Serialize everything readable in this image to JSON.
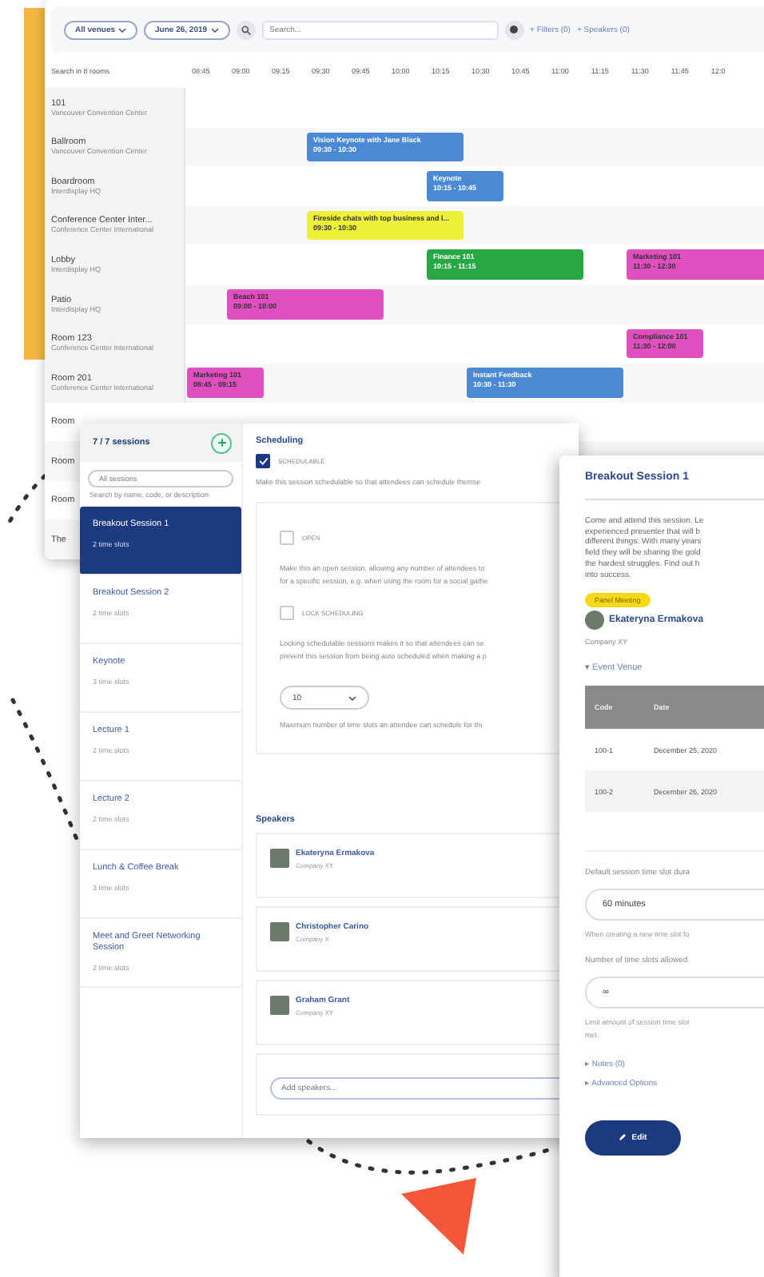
{
  "timeline": {
    "filters": [
      {
        "label": "All venues"
      },
      {
        "label": "June 26, 2019"
      }
    ],
    "search": {
      "placeholder": "Search..."
    },
    "links": [
      "+ Filters (0)",
      "+ Speakers (0)"
    ],
    "rooms_header": "Search in 8 rooms",
    "times": [
      "08:45",
      "09:00",
      "09:15",
      "09:30",
      "09:45",
      "10:00",
      "10:15",
      "10:30",
      "10:45",
      "11:00",
      "11:15",
      "11:30",
      "11:45",
      "12:0"
    ],
    "rooms": [
      {
        "name": "101",
        "venue": "Vancouver Convention Center"
      },
      {
        "name": "Ballroom",
        "venue": "Vancouver Convention Center",
        "events": [
          {
            "title": "Vision Keynote with Jane Black",
            "time": "09:30 - 10:30",
            "color": "#4a8ad4"
          }
        ]
      },
      {
        "name": "Boardroom",
        "venue": "Interdisplay HQ",
        "events": [
          {
            "title": "Keynote",
            "time": "10:15 - 10:45",
            "color": "#4a8ad4"
          }
        ]
      },
      {
        "name": "Conference Center Inter...",
        "venue": "Conference Center International",
        "events": [
          {
            "title": "Fireside chats with top business and l...",
            "time": "09:30 - 10:30",
            "color": "#eef03a"
          }
        ]
      },
      {
        "name": "Lobby",
        "venue": "Interdisplay HQ",
        "events": [
          {
            "title": "Finance 101",
            "time": "10:15 - 11:15",
            "color": "#28a745"
          },
          {
            "title": "Marketing 101",
            "time": "11:30 - 12:30",
            "color": "#e04fc0"
          }
        ]
      },
      {
        "name": "Patio",
        "venue": "Interdisplay HQ",
        "events": [
          {
            "title": "Beach 101",
            "time": "09:00 - 10:00",
            "color": "#e04fc0"
          }
        ]
      },
      {
        "name": "Room 123",
        "venue": "Conference Center International",
        "events": [
          {
            "title": "Compliance 101",
            "time": "11:30 - 12:00",
            "color": "#e04fc0"
          }
        ]
      },
      {
        "name": "Room 201",
        "venue": "Conference Center International",
        "events": [
          {
            "title": "Marketing 101",
            "time": "08:45 - 09:15",
            "color": "#e04fc0"
          },
          {
            "title": "Instant Feedback",
            "time": "10:30 - 11:30",
            "color": "#4a8ad4"
          }
        ]
      },
      {
        "name": "Room"
      },
      {
        "name": "Room"
      },
      {
        "name": "Room"
      },
      {
        "name": "The"
      }
    ]
  },
  "sessions_window": {
    "sidebar": {
      "count": "7 / 7 sessions",
      "search": {
        "placeholder": "All sessions"
      },
      "hint": "Search by name, code, or description",
      "sessions": [
        {
          "name": "Breakout Session 1",
          "slots": "2 time slots",
          "selected": true
        },
        {
          "name": "Breakout Session 2",
          "slots": "2 time slots",
          "selected": false
        },
        {
          "name": "Keynote",
          "slots": "3 time slots",
          "selected": false
        },
        {
          "name": "Lecture 1",
          "slots": "2 time slots",
          "selected": false
        },
        {
          "name": "Lecture 2",
          "slots": "2 time slots",
          "selected": false
        },
        {
          "name": "Lunch & Coffee Break",
          "slots": "3 time slots",
          "selected": false
        },
        {
          "name": "Meet and Greet Networking Session",
          "slots": "2 time slots",
          "selected": false
        }
      ]
    },
    "scheduling": {
      "title": "Scheduling",
      "schedulable": {
        "label": "SCHEDULABLE",
        "checked": true
      },
      "description": "Make this session schedulable so that attendees can schedule themse",
      "options": [
        {
          "label": "OPEN",
          "checked": false,
          "description_lines": [
            "Make this an open session, allowing any number of attendees to",
            "for a specific session, e.g. when using the room for a social gathe"
          ]
        },
        {
          "label": "LOCK SCHEDULING",
          "checked": false,
          "description_lines": [
            "Locking schedulable sessions makes it so that attendees can se",
            "prevent this session from being auto scheduled when making a p"
          ]
        }
      ],
      "max_slots": {
        "value": "10",
        "hint": "Maximum number of time slots an attendee can schedule for thi"
      }
    },
    "speakers": {
      "title": "Speakers",
      "items": [
        {
          "name": "Ekateryna Ermakova",
          "company": "Company XY"
        },
        {
          "name": "Christopher Carino",
          "company": "Company X"
        },
        {
          "name": "Graham Grant",
          "company": "Company XY"
        }
      ],
      "add": {
        "placeholder": "Add speakers..."
      }
    }
  },
  "details": {
    "title": "Breakout Session 1",
    "description_lines": [
      "Come and attend this session. Le",
      "experienced presenter that will b",
      "different things. With many years",
      "field they will be sharing the gold",
      "the hardest struggles. Find out h",
      "into success."
    ],
    "tag": "Panel Meeting",
    "speaker": {
      "name": "Ekateryna Ermakova",
      "company": "Company XY"
    },
    "venue_toggle": "▾ Event Venue",
    "table": {
      "columns": [
        "Code",
        "Date"
      ],
      "rows": [
        [
          "100-1",
          "December 25, 2020"
        ],
        [
          "100-2",
          "December 26, 2020"
        ]
      ]
    },
    "duration": {
      "label": "Default session time slot dura",
      "value": "60 minutes",
      "hint": "When creating a new time slot fo"
    },
    "slots_allowed": {
      "label": "Number of time slots allowed",
      "value": "∞",
      "hint_lines": [
        "Limit amount of session time slot",
        "met."
      ]
    },
    "links": [
      "▸ Notes (0)",
      "▸ Advanced Options"
    ],
    "edit": "Edit"
  }
}
